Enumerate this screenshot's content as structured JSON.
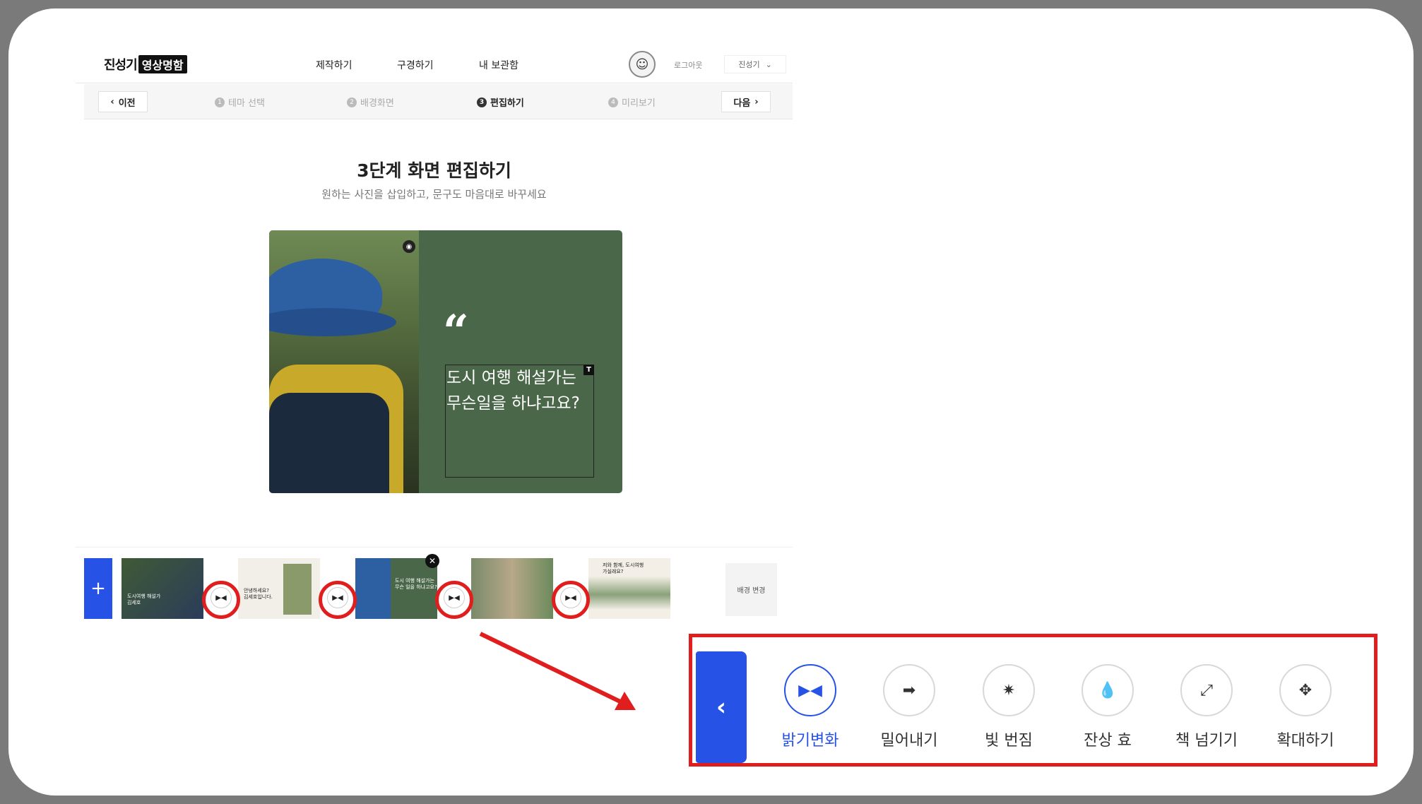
{
  "header": {
    "logo_part1": "진성기",
    "logo_part2": "영상명함",
    "nav": [
      "제작하기",
      "구경하기",
      "내 보관함"
    ],
    "avatar_icon": "smiley-icon",
    "logout": "로그아웃",
    "user": "진성기"
  },
  "stepbar": {
    "prev": "이전",
    "next": "다음",
    "steps": [
      {
        "num": "1",
        "label": "테마 선택"
      },
      {
        "num": "2",
        "label": "배경화면"
      },
      {
        "num": "3",
        "label": "편집하기"
      },
      {
        "num": "4",
        "label": "미리보기"
      }
    ],
    "active_step": 3
  },
  "main": {
    "title": "3단계 화면 편집하기",
    "subtitle": "원하는 사진을 삽입하고, 문구도 마음대로 바꾸세요"
  },
  "canvas": {
    "quote_mark": "“",
    "text_line1": "도시 여행 해설가는",
    "text_line2": "무슨일을 하냐고요?",
    "text_icon": "T",
    "bg_color": "#4a6849"
  },
  "timeline": {
    "add_label": "+",
    "bg_change": "배경 변경",
    "thumbs": [
      {
        "caption": "도시여행 해설가\n김세호"
      },
      {
        "caption": "안녕하세요?\n김세호입니다."
      },
      {
        "caption": "도시 여행 해설가는\n무슨 일을 하냐고요?"
      },
      {
        "caption": ""
      },
      {
        "caption": "저와 함께, 도시여행\n가실래요?"
      }
    ],
    "transition_icon": "bowtie-icon"
  },
  "effects_panel": {
    "back_icon": "‹",
    "items": [
      {
        "label": "밝기변화",
        "icon": "▶◀",
        "active": true
      },
      {
        "label": "밀어내기",
        "icon": "➡",
        "active": false
      },
      {
        "label": "빛 번짐",
        "icon": "✷",
        "active": false
      },
      {
        "label": "잔상 효",
        "icon": "💧",
        "active": false
      },
      {
        "label": "책 넘기기",
        "icon": "⤢",
        "active": false
      },
      {
        "label": "확대하기",
        "icon": "✥",
        "active": false
      }
    ]
  },
  "colors": {
    "accent": "#2752e6",
    "highlight": "#e01e1e"
  }
}
